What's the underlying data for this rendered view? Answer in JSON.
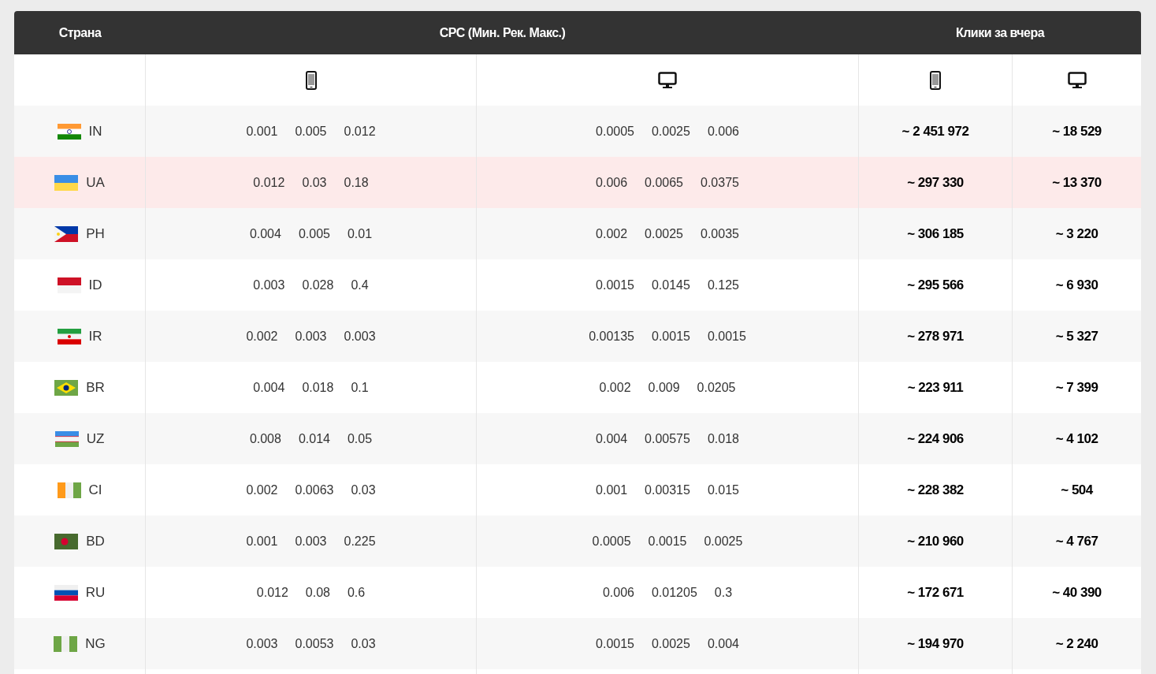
{
  "header": {
    "columns": [
      "Страна",
      "CPC (Мин. Рек. Макс.)",
      "Клики за вчера"
    ]
  },
  "device_row": [
    {
      "kind": "mobile"
    },
    {
      "kind": "desktop"
    },
    {
      "kind": "mobile"
    },
    {
      "kind": "desktop"
    }
  ],
  "rows": [
    {
      "country": "IN",
      "highlighted": false,
      "cpc_mobile": [
        "0.001",
        "0.005",
        "0.012"
      ],
      "cpc_desktop": [
        "0.0005",
        "0.0025",
        "0.006"
      ],
      "clicks_mobile": "~ 2 451 972",
      "clicks_desktop": "~ 18 529"
    },
    {
      "country": "UA",
      "highlighted": true,
      "cpc_mobile": [
        "0.012",
        "0.03",
        "0.18"
      ],
      "cpc_desktop": [
        "0.006",
        "0.0065",
        "0.0375"
      ],
      "clicks_mobile": "~ 297 330",
      "clicks_desktop": "~ 13 370"
    },
    {
      "country": "PH",
      "highlighted": false,
      "cpc_mobile": [
        "0.004",
        "0.005",
        "0.01"
      ],
      "cpc_desktop": [
        "0.002",
        "0.0025",
        "0.0035"
      ],
      "clicks_mobile": "~ 306 185",
      "clicks_desktop": "~ 3 220"
    },
    {
      "country": "ID",
      "highlighted": false,
      "cpc_mobile": [
        "0.003",
        "0.028",
        "0.4"
      ],
      "cpc_desktop": [
        "0.0015",
        "0.0145",
        "0.125"
      ],
      "clicks_mobile": "~ 295 566",
      "clicks_desktop": "~ 6 930"
    },
    {
      "country": "IR",
      "highlighted": false,
      "cpc_mobile": [
        "0.002",
        "0.003",
        "0.003"
      ],
      "cpc_desktop": [
        "0.00135",
        "0.0015",
        "0.0015"
      ],
      "clicks_mobile": "~ 278 971",
      "clicks_desktop": "~ 5 327"
    },
    {
      "country": "BR",
      "highlighted": false,
      "cpc_mobile": [
        "0.004",
        "0.018",
        "0.1"
      ],
      "cpc_desktop": [
        "0.002",
        "0.009",
        "0.0205"
      ],
      "clicks_mobile": "~ 223 911",
      "clicks_desktop": "~ 7 399"
    },
    {
      "country": "UZ",
      "highlighted": false,
      "cpc_mobile": [
        "0.008",
        "0.014",
        "0.05"
      ],
      "cpc_desktop": [
        "0.004",
        "0.00575",
        "0.018"
      ],
      "clicks_mobile": "~ 224 906",
      "clicks_desktop": "~ 4 102"
    },
    {
      "country": "CI",
      "highlighted": false,
      "cpc_mobile": [
        "0.002",
        "0.0063",
        "0.03"
      ],
      "cpc_desktop": [
        "0.001",
        "0.00315",
        "0.015"
      ],
      "clicks_mobile": "~ 228 382",
      "clicks_desktop": "~ 504"
    },
    {
      "country": "BD",
      "highlighted": false,
      "cpc_mobile": [
        "0.001",
        "0.003",
        "0.225"
      ],
      "cpc_desktop": [
        "0.0005",
        "0.0015",
        "0.0025"
      ],
      "clicks_mobile": "~ 210 960",
      "clicks_desktop": "~ 4 767"
    },
    {
      "country": "RU",
      "highlighted": false,
      "cpc_mobile": [
        "0.012",
        "0.08",
        "0.6"
      ],
      "cpc_desktop": [
        "0.006",
        "0.01205",
        "0.3"
      ],
      "clicks_mobile": "~ 172 671",
      "clicks_desktop": "~ 40 390"
    },
    {
      "country": "NG",
      "highlighted": false,
      "cpc_mobile": [
        "0.003",
        "0.0053",
        "0.03"
      ],
      "cpc_desktop": [
        "0.0015",
        "0.0025",
        "0.004"
      ],
      "clicks_mobile": "~ 194 970",
      "clicks_desktop": "~ 2 240"
    }
  ]
}
